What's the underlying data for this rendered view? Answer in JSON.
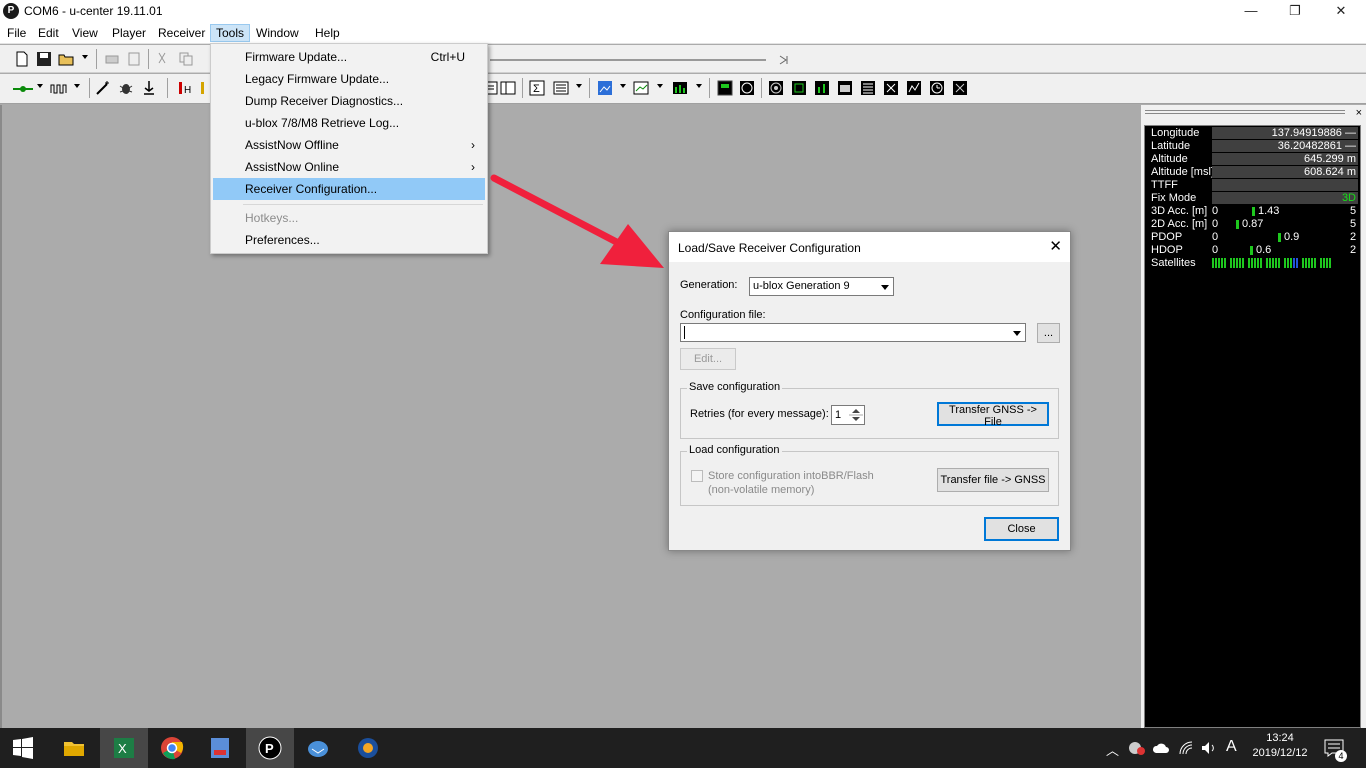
{
  "window": {
    "app_icon_letter": "P",
    "title": "COM6 - u-center 19.11.01",
    "minimize_glyph": "—",
    "maximize_glyph": "❐",
    "close_glyph": "✕"
  },
  "menubar": {
    "items": [
      "File",
      "Edit",
      "View",
      "Player",
      "Receiver",
      "Tools",
      "Window",
      "Help"
    ],
    "active": "Tools"
  },
  "tools_menu": {
    "items": [
      {
        "label": "Firmware Update...",
        "shortcut": "Ctrl+U"
      },
      {
        "label": "Legacy Firmware Update..."
      },
      {
        "label": "Dump Receiver Diagnostics..."
      },
      {
        "label": "u-blox 7/8/M8 Retrieve Log..."
      },
      {
        "label": "AssistNow Offline",
        "arrow": "›"
      },
      {
        "label": "AssistNow Online",
        "arrow": "›"
      },
      {
        "label": "Receiver Configuration..."
      },
      {
        "label": "Hotkeys..."
      },
      {
        "label": "Preferences..."
      }
    ]
  },
  "data_panel": {
    "close_glyph": "×",
    "rows": [
      {
        "label": "Longitude",
        "value": "137.94919886 —"
      },
      {
        "label": "Latitude",
        "value": "36.20482861 —"
      },
      {
        "label": "Altitude",
        "value": "645.299 m"
      },
      {
        "label": "Altitude [msl]",
        "value": "608.624 m"
      },
      {
        "label": "TTFF",
        "value": ""
      },
      {
        "label": "Fix Mode",
        "value": "3D"
      }
    ],
    "bars": [
      {
        "label": "3D Acc. [m]",
        "min": "0",
        "value": "1.43",
        "max": "5",
        "level": 1.43
      },
      {
        "label": "2D Acc. [m]",
        "min": "0",
        "value": "0.87",
        "max": "5",
        "level": 0.87
      },
      {
        "label": "PDOP",
        "min": "0",
        "value": "0.9",
        "max": "2",
        "level": 0.9
      },
      {
        "label": "HDOP",
        "min": "0",
        "value": "0.6",
        "max": "2",
        "level": 0.6
      }
    ],
    "satellites_label": "Satellites"
  },
  "dialog": {
    "title": "Load/Save Receiver Configuration",
    "close_glyph": "✕",
    "generation_label": "Generation:",
    "generation_value": "u-blox Generation 9",
    "config_file_label": "Configuration file:",
    "config_file_value": "",
    "browse_label": "...",
    "edit_label": "Edit...",
    "save_group": "Save configuration",
    "retries_label": "Retries (for every message):",
    "retries_value": "1",
    "transfer_gnss_file": "Transfer GNSS -> File",
    "load_group": "Load configuration",
    "store_label_1": "Store configuration intoBBR/Flash",
    "store_label_2": "(non-volatile memory)",
    "transfer_file_gnss": "Transfer file -> GNSS",
    "close_label": "Close"
  },
  "taskbar": {
    "time": "13:24",
    "date": "2019/12/12",
    "ime": "A",
    "notification_count": "4"
  }
}
